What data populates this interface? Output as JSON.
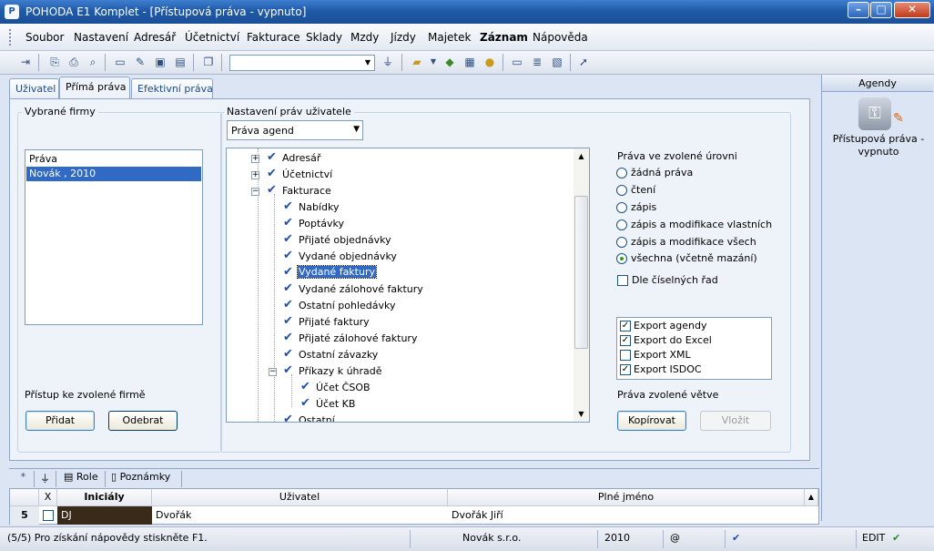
{
  "window": {
    "title": "POHODA E1 Komplet - [Přístupová práva - vypnuto]",
    "app_icon": "P",
    "buttons": {
      "minimize": "–",
      "maximize": "□",
      "close": "✕"
    }
  },
  "menu": [
    "Soubor",
    "Nastavení",
    "Adresář",
    "Účetnictví",
    "Fakturace",
    "Sklady",
    "Mzdy",
    "Jízdy",
    "Majetek",
    "Záznam",
    "Nápověda"
  ],
  "tabs": [
    "Uživatel",
    "Přímá práva",
    "Efektivní práva"
  ],
  "firms": {
    "label": "Vybrané firmy",
    "items": [
      "Práva",
      "Novák , 2010"
    ],
    "access_label": "Přístup ke zvolené firmě",
    "add_button": "Přidat",
    "remove_button": "Odebrat"
  },
  "rights": {
    "label": "Nastavení práv uživatele",
    "dropdown_value": "Práva agend",
    "tree": [
      "Adresář",
      "Účetnictví",
      "Fakturace",
      "Nabídky",
      "Poptávky",
      "Přijaté objednávky",
      "Vydané objednávky",
      "Vydané faktury",
      "Vydané zálohové faktury",
      "Ostatní pohledávky",
      "Přijaté faktury",
      "Přijaté zálohové faktury",
      "Ostatní závazky",
      "Příkazy k úhradě",
      "Účet ČSOB",
      "Účet KB",
      "Ostatní"
    ],
    "check_glyph": "✔",
    "level_label": "Práva ve zvolené úrovni",
    "levels": [
      "žádná práva",
      "čtení",
      "zápis",
      "zápis a modifikace vlastních",
      "zápis a modifikace všech",
      "všechna (včetně mazání)"
    ],
    "selected_level": "všechna (včetně mazání)",
    "series_label": "Dle číselných řad",
    "exports": [
      {
        "label": "Export agendy",
        "checked": true
      },
      {
        "label": "Export do Excel",
        "checked": true
      },
      {
        "label": "Export XML",
        "checked": false
      },
      {
        "label": "Export ISDOC",
        "checked": true
      }
    ],
    "branch_label": "Práva zvolené větve",
    "copy_button": "Kopírovat",
    "paste_button": "Vložit"
  },
  "agendy": {
    "header": "Agendy",
    "item_label": "Přístupová práva - vypnuto"
  },
  "bottom_tabs": [
    "*",
    "Role",
    "Poznámky"
  ],
  "grid": {
    "headers": [
      "X",
      "Iniciály",
      "Uživatel",
      "Plné jméno"
    ],
    "row": {
      "num": "5",
      "initials": "DJ",
      "user": "Dvořák",
      "fullname": "Dvořák Jiří"
    }
  },
  "status": {
    "text": "(5/5) Pro získání nápovědy stiskněte F1.",
    "company": "Novák s.r.o.",
    "year": "2010",
    "at": "@",
    "mode": "EDIT"
  },
  "colors": {
    "title_bar": "#1f5aa8",
    "selection": "#316ac5",
    "panel": "#eef3fa",
    "check": "#1f4fa8"
  }
}
